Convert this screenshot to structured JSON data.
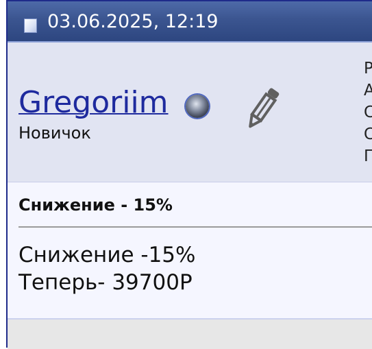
{
  "post": {
    "date": "03.06.2025, 12:19",
    "icon": "document-icon"
  },
  "user": {
    "name": "Gregoriim",
    "rank": "Новичок",
    "status_icon": "offline-status-icon",
    "edit_icon": "pencil-icon",
    "info_letters": [
      "Р",
      "А",
      "С",
      "С",
      "П"
    ]
  },
  "content": {
    "title": "Снижение - 15%",
    "body_lines": [
      "Снижение -15%",
      "Теперь- 39700Р"
    ]
  },
  "colors": {
    "header": "#3b5590",
    "username_link": "#1e2a9e",
    "user_panel": "#e1e4f2",
    "content_panel": "#f5f6ff",
    "border": "#1e2b8a"
  }
}
